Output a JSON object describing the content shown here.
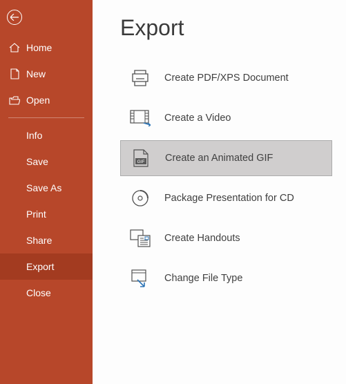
{
  "sidebar": {
    "top": [
      {
        "label": "Home"
      },
      {
        "label": "New"
      },
      {
        "label": "Open"
      }
    ],
    "items": [
      {
        "label": "Info"
      },
      {
        "label": "Save"
      },
      {
        "label": "Save As"
      },
      {
        "label": "Print"
      },
      {
        "label": "Share"
      },
      {
        "label": "Export"
      },
      {
        "label": "Close"
      }
    ],
    "selected_index": 5
  },
  "main": {
    "title": "Export",
    "options": [
      {
        "label": "Create PDF/XPS Document"
      },
      {
        "label": "Create a Video"
      },
      {
        "label": "Create an Animated GIF"
      },
      {
        "label": "Package Presentation for CD"
      },
      {
        "label": "Create Handouts"
      },
      {
        "label": "Change File Type"
      }
    ],
    "selected_option_index": 2
  },
  "colors": {
    "brand": "#b7472a",
    "brand_dark": "#a33b20",
    "selected_bg": "#d0cece",
    "selected_border": "#acacac"
  }
}
